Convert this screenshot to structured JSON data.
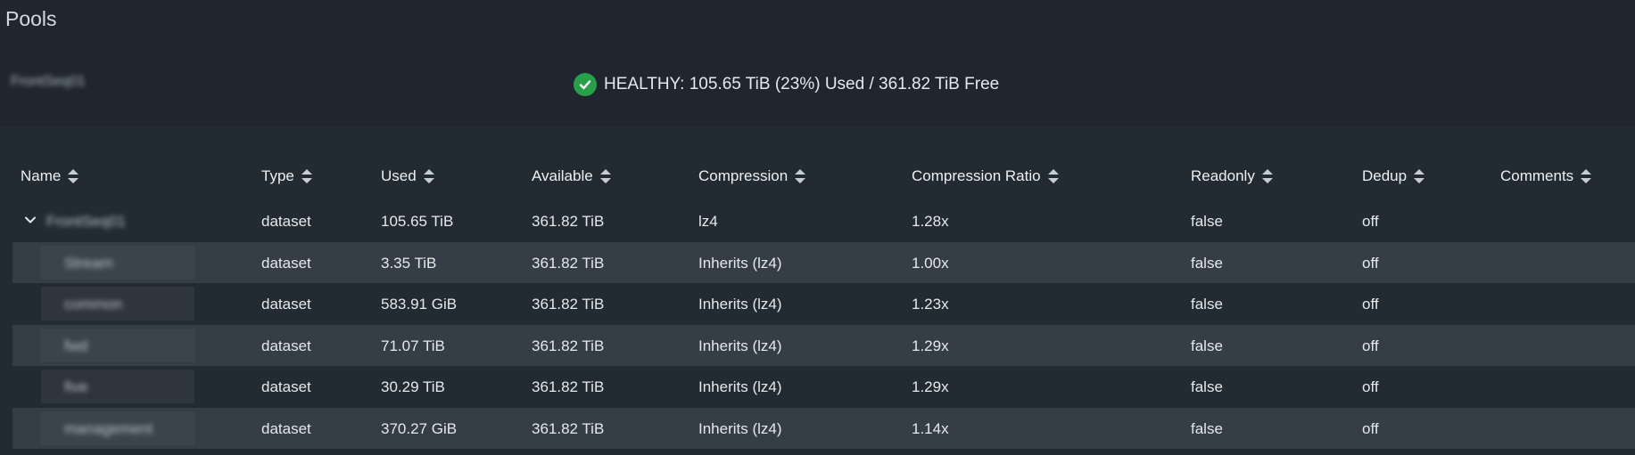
{
  "page": {
    "title": "Pools"
  },
  "pool": {
    "name": "FrontSeq01",
    "health_text": "HEALTHY: 105.65 TiB (23%) Used / 361.82 TiB Free",
    "health_color": "#28a04a"
  },
  "table": {
    "columns": [
      {
        "label": "Name"
      },
      {
        "label": "Type"
      },
      {
        "label": "Used"
      },
      {
        "label": "Available"
      },
      {
        "label": "Compression"
      },
      {
        "label": "Compression Ratio"
      },
      {
        "label": "Readonly"
      },
      {
        "label": "Dedup"
      },
      {
        "label": "Comments"
      }
    ],
    "rows": [
      {
        "name": "FrontSeq01",
        "type": "dataset",
        "used": "105.65 TiB",
        "available": "361.82 TiB",
        "compression": "lz4",
        "ratio": "1.28x",
        "readonly": "false",
        "dedup": "off",
        "comments": ""
      },
      {
        "name": "Stream",
        "type": "dataset",
        "used": "3.35 TiB",
        "available": "361.82 TiB",
        "compression": "Inherits (lz4)",
        "ratio": "1.00x",
        "readonly": "false",
        "dedup": "off",
        "comments": ""
      },
      {
        "name": "common",
        "type": "dataset",
        "used": "583.91 GiB",
        "available": "361.82 TiB",
        "compression": "Inherits (lz4)",
        "ratio": "1.23x",
        "readonly": "false",
        "dedup": "off",
        "comments": ""
      },
      {
        "name": "fwd",
        "type": "dataset",
        "used": "71.07 TiB",
        "available": "361.82 TiB",
        "compression": "Inherits (lz4)",
        "ratio": "1.29x",
        "readonly": "false",
        "dedup": "off",
        "comments": ""
      },
      {
        "name": "five",
        "type": "dataset",
        "used": "30.29 TiB",
        "available": "361.82 TiB",
        "compression": "Inherits (lz4)",
        "ratio": "1.29x",
        "readonly": "false",
        "dedup": "off",
        "comments": ""
      },
      {
        "name": "management",
        "type": "dataset",
        "used": "370.27 GiB",
        "available": "361.82 TiB",
        "compression": "Inherits (lz4)",
        "ratio": "1.14x",
        "readonly": "false",
        "dedup": "off",
        "comments": ""
      }
    ]
  }
}
